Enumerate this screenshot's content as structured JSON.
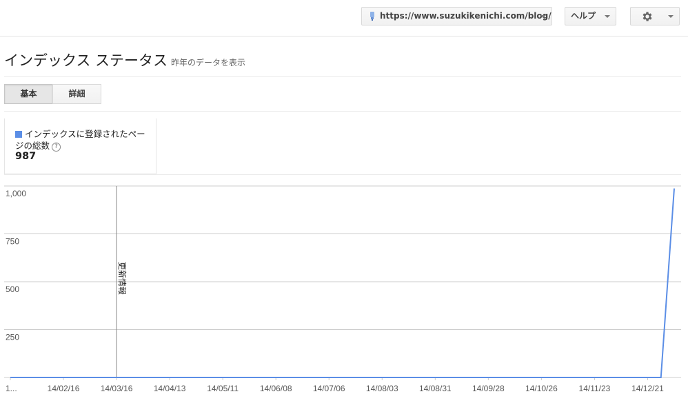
{
  "header": {
    "site_url": "https://www.suzukikenichi.com/blog/",
    "help_label": "ヘルプ",
    "site_icon": "site-favicon-icon",
    "settings_icon": "gear-icon"
  },
  "page": {
    "title": "インデックス ステータス",
    "subtitle": "昨年のデータを表示"
  },
  "tabs": [
    {
      "label": "基本",
      "active": true
    },
    {
      "label": "詳細",
      "active": false
    }
  ],
  "legend": {
    "label": "インデックスに登録されたページの総数",
    "help_icon": "question-mark-icon",
    "help_glyph": "?",
    "value": "987",
    "color": "#5b8ee6"
  },
  "chart_data": {
    "type": "line",
    "x_ticks": [
      "1...",
      "14/02/16",
      "14/03/16",
      "14/04/13",
      "14/05/11",
      "14/06/08",
      "14/07/06",
      "14/08/03",
      "14/08/31",
      "14/09/28",
      "14/10/26",
      "14/11/23",
      "14/12/21"
    ],
    "y_ticks": [
      "1,000",
      "750",
      "500",
      "250"
    ],
    "ylim": [
      0,
      1000
    ],
    "grid": true,
    "annotation": {
      "label": "更新情報",
      "at": "14/03/16"
    },
    "series": [
      {
        "color": "#5b8ee6",
        "points": [
          {
            "x": "2014-01-19",
            "y": 0
          },
          {
            "x": "2014-12-28",
            "y": 0
          },
          {
            "x": "2015-01-04",
            "y": 987
          }
        ]
      }
    ]
  }
}
